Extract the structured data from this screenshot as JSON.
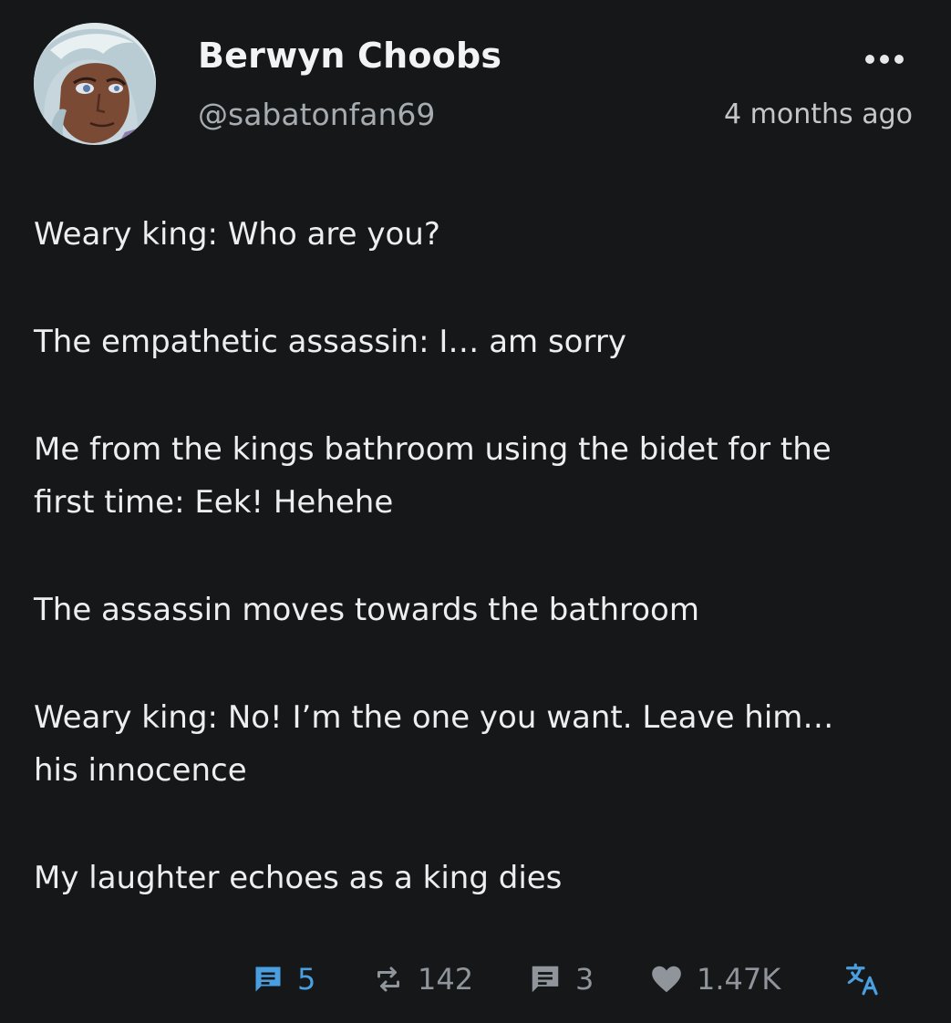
{
  "post": {
    "author": {
      "display_name": "Berwyn Choobs",
      "handle": "@sabatonfan69"
    },
    "timestamp": "4 months ago",
    "paragraphs": [
      "Weary king: Who are you?",
      "The empathetic assassin: I… am sorry",
      "Me from the kings bathroom using the bidet for the first time: Eek! Hehehe",
      "The assassin moves towards the bathroom",
      "Weary king: No! I’m the one you want. Leave him… his innocence",
      "My laughter echoes as a king dies"
    ],
    "actions": {
      "replies": {
        "icon": "comment-box-icon",
        "count": "5"
      },
      "reposts": {
        "icon": "repost-icon",
        "count": "142"
      },
      "quotes": {
        "icon": "quote-icon",
        "count": "3"
      },
      "likes": {
        "icon": "heart-icon",
        "count": "1.47K"
      },
      "translate": {
        "icon": "translate-icon"
      }
    }
  },
  "colors": {
    "background": "#151719",
    "accent": "#4a9fe0",
    "muted": "#8f959a",
    "text": "#eceef0"
  }
}
